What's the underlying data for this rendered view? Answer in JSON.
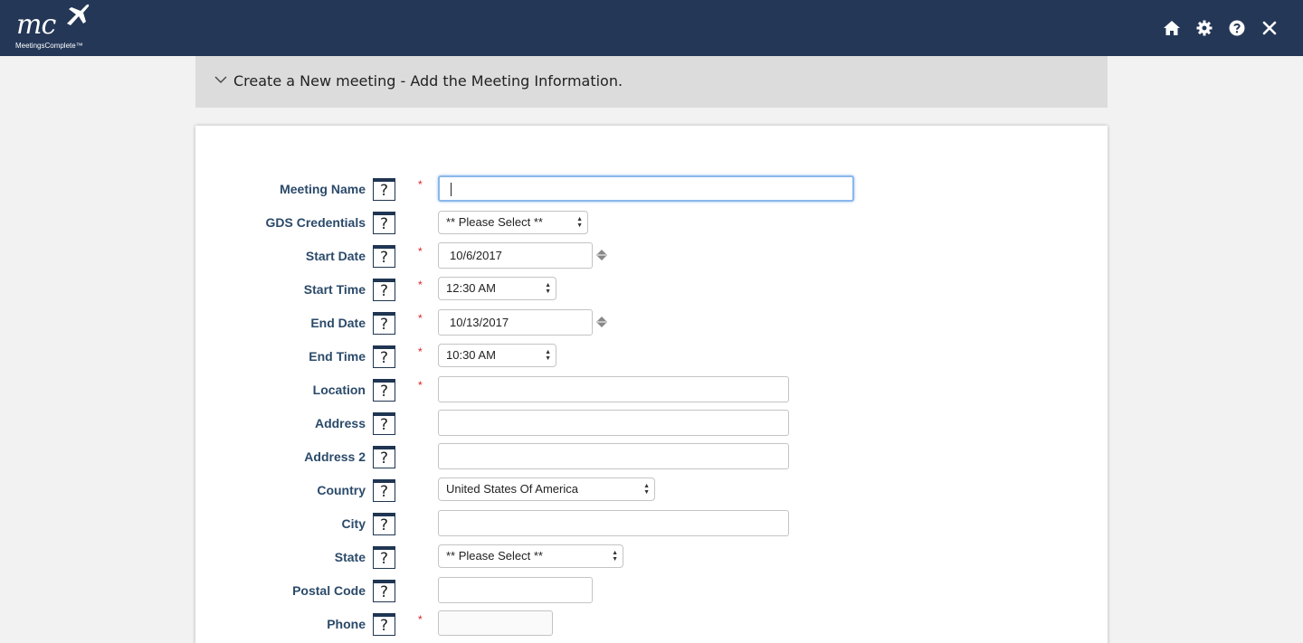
{
  "brand": {
    "logo_text": "mc",
    "tagline": "MeetingsComplete™"
  },
  "header_icons": [
    "home-icon",
    "gear-icon",
    "help-icon",
    "close-icon"
  ],
  "accordion": {
    "title": "Create a New meeting - Add the Meeting Information."
  },
  "help_glyph": "?",
  "required_mark": "*",
  "form": {
    "meeting_name": {
      "label": "Meeting Name",
      "value": ""
    },
    "gds_credentials": {
      "label": "GDS Credentials",
      "value": "** Please Select **"
    },
    "start_date": {
      "label": "Start Date",
      "value": "10/6/2017"
    },
    "start_time": {
      "label": "Start Time",
      "value": "12:30 AM"
    },
    "end_date": {
      "label": "End Date",
      "value": "10/13/2017"
    },
    "end_time": {
      "label": "End Time",
      "value": "10:30 AM"
    },
    "location": {
      "label": "Location",
      "value": ""
    },
    "address": {
      "label": "Address",
      "value": ""
    },
    "address2": {
      "label": "Address 2",
      "value": ""
    },
    "country": {
      "label": "Country",
      "value": "United States Of America"
    },
    "city": {
      "label": "City",
      "value": ""
    },
    "state": {
      "label": "State",
      "value": "** Please Select **"
    },
    "postal_code": {
      "label": "Postal Code",
      "value": ""
    },
    "phone": {
      "label": "Phone",
      "value": ""
    }
  },
  "colors": {
    "header_bg": "#243757",
    "label": "#2b4a6a",
    "required": "#e02020",
    "focus": "#8ab7ea"
  }
}
